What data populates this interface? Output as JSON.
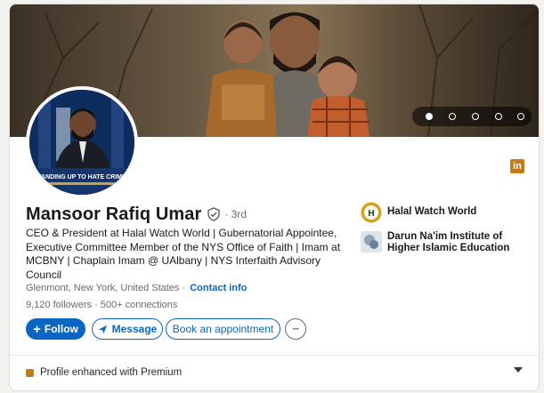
{
  "profile": {
    "name": "Mansoor Rafiq Umar",
    "degree": "· 3rd",
    "headline": "CEO & President at Halal Watch World | Gubernatorial Appointee, Executive Committee Member of the NYS Office of Faith | Imam at MCBNY | Chaplain Imam @ UAlbany | NYS Interfaith Advisory Council",
    "location": "Glenmont, New York, United States",
    "location_sep": " · ",
    "contact_label": "Contact info",
    "followers": "9,120 followers",
    "connections_sep": " · ",
    "connections": "500+ connections",
    "avatar_sign_text": "STANDING UP TO HATE CRIMES"
  },
  "banner": {
    "slides": 5,
    "active_slide": 1
  },
  "actions": {
    "follow": "Follow",
    "message": "Message",
    "appointment": "Book an appointment",
    "more": "···"
  },
  "orgs": [
    {
      "name": "Halal Watch World",
      "logo_letter": "H"
    },
    {
      "name": "Darun Na'im Institute of Higher Islamic Education"
    }
  ],
  "premium": {
    "label": "Profile enhanced with Premium"
  },
  "icons": {
    "linkedin": "in",
    "verified": "verified-shield-icon",
    "follow_plus": "+",
    "message_send": "send-icon",
    "expand": "chevron-down-icon"
  },
  "colors": {
    "accent": "#0a66c2",
    "premium_gold": "#c37d16"
  }
}
